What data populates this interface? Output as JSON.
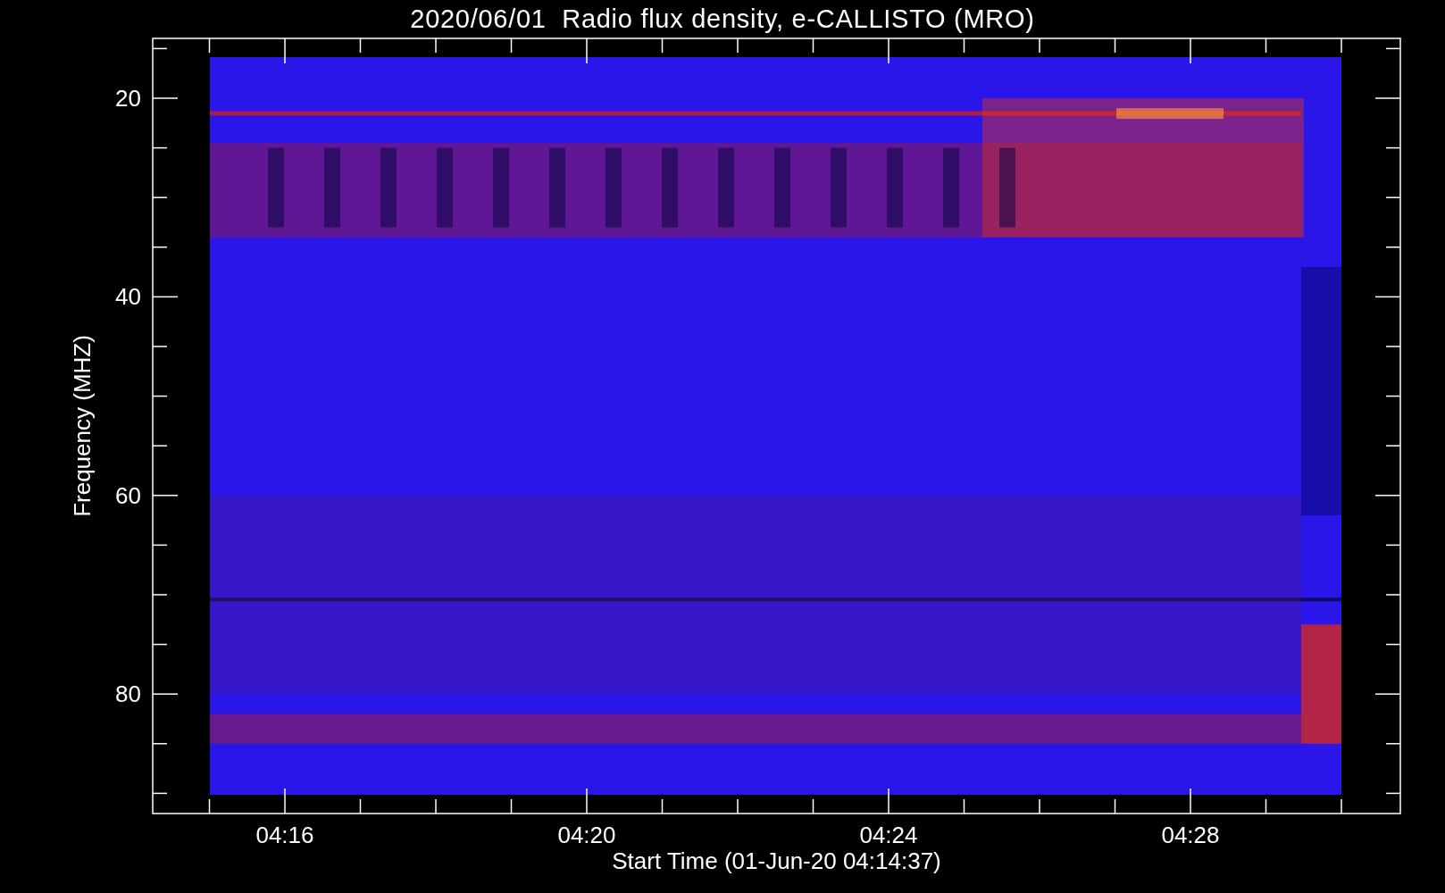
{
  "title": "2020/06/01  Radio flux density, e-CALLISTO (MRO)",
  "y_axis": {
    "label": "Frequency (MHZ)",
    "ticks": [
      "20",
      "40",
      "60",
      "80"
    ]
  },
  "x_axis": {
    "label": "Start Time (01-Jun-20 04:14:37)",
    "ticks": [
      "04:16",
      "04:20",
      "04:24",
      "04:28"
    ]
  }
}
